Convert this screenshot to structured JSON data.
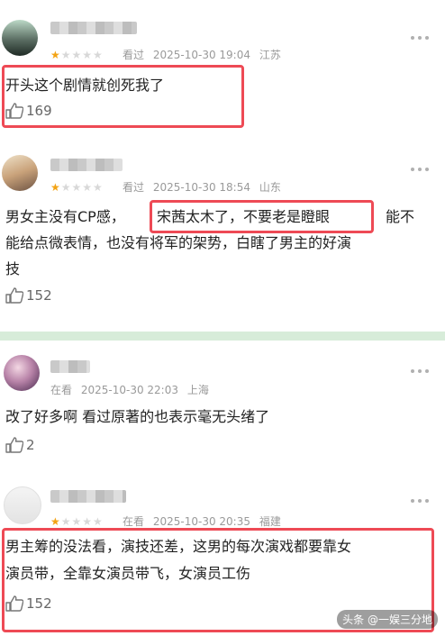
{
  "comments": [
    {
      "rating": 1,
      "status": "看过",
      "date": "2025-10-30 19:04",
      "location": "江苏",
      "lines": [
        "开头这个剧情就创死我了"
      ],
      "likes": "169"
    },
    {
      "rating": 1,
      "status": "看过",
      "date": "2025-10-30 18:54",
      "location": "山东",
      "line1_a": "男女主没有CP感，",
      "line1_b": "宋茜太木了，不要老是瞪眼",
      "line1_c": "能不",
      "line2": "能给点微表情，也没有将军的架势，白瞎了男主的好演",
      "line3": "技",
      "likes": "152"
    },
    {
      "rating": 0,
      "status": "在看",
      "date": "2025-10-30 22:03",
      "location": "上海",
      "lines": [
        "改了好多啊 看过原著的也表示毫无头绪了"
      ],
      "likes": "2"
    },
    {
      "rating": 1,
      "status": "在看",
      "date": "2025-10-30 20:35",
      "location": "福建",
      "lines": [
        "男主筹的没法看，演技还差，这男的每次演戏都要靠女",
        "演员带，全靠女演员带飞，女演员工伤"
      ],
      "likes": "152"
    }
  ],
  "watermark": "头条 @一娱三分地",
  "colors": {
    "star": "#f3a314",
    "highlight": "#ee4a55",
    "meta": "#9a9a9a"
  }
}
